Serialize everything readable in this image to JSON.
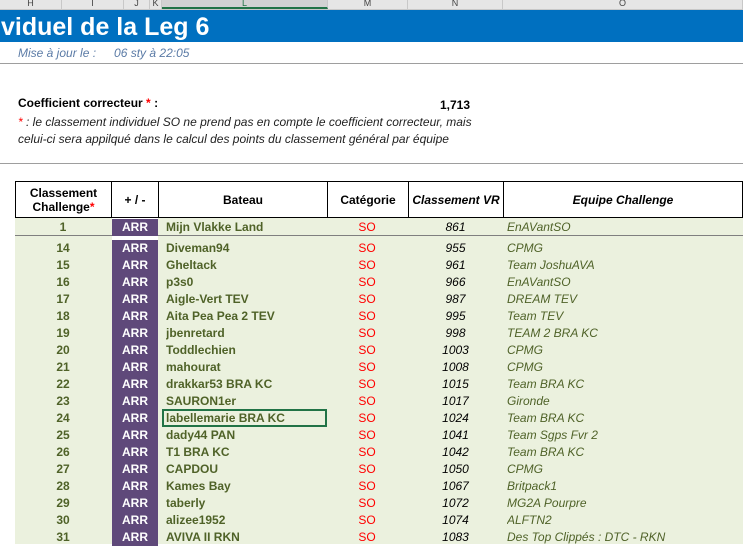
{
  "column_headers": [
    {
      "label": "H",
      "sel": false
    },
    {
      "label": "I",
      "sel": false
    },
    {
      "label": "J",
      "sel": false
    },
    {
      "label": "K",
      "sel": false
    },
    {
      "label": "L",
      "sel": true
    },
    {
      "label": "M",
      "sel": false
    },
    {
      "label": "N",
      "sel": false
    },
    {
      "label": "O",
      "sel": false
    }
  ],
  "title": "viduel de la Leg 6",
  "update": {
    "label": "Mise à jour le :",
    "value": "06 sty à 22:05"
  },
  "coefficient": {
    "label": "Coefficient correcteur",
    "star": "*",
    "colon": ":",
    "value": "1,713",
    "note_star": "*",
    "note": ": le classement individuel SO ne prend pas en compte le coefficient correcteur, mais celui-ci sera appilqué dans le calcul des points du classement général par équipe"
  },
  "table": {
    "headers": {
      "rank_line1": "Classement",
      "rank_line2": "Challenge",
      "rank_star": "*",
      "plusminus": "+ / -",
      "boat": "Bateau",
      "category": "Catégorie",
      "vr": "Classement VR",
      "team": "Equipe Challenge"
    },
    "rows": [
      {
        "rank": "1",
        "pm": "ARR",
        "boat": "Mijn Vlakke Land",
        "cat": "SO",
        "vr": "861",
        "team": "EnAVantSO"
      },
      {
        "rank": "14",
        "pm": "ARR",
        "boat": "Diveman94",
        "cat": "SO",
        "vr": "955",
        "team": "CPMG"
      },
      {
        "rank": "15",
        "pm": "ARR",
        "boat": "Gheltack",
        "cat": "SO",
        "vr": "961",
        "team": "Team JoshuAVA"
      },
      {
        "rank": "16",
        "pm": "ARR",
        "boat": "p3s0",
        "cat": "SO",
        "vr": "966",
        "team": "EnAVantSO"
      },
      {
        "rank": "17",
        "pm": "ARR",
        "boat": "Aigle-Vert TEV",
        "cat": "SO",
        "vr": "987",
        "team": "DREAM TEV"
      },
      {
        "rank": "18",
        "pm": "ARR",
        "boat": "Aita Pea Pea 2 TEV",
        "cat": "SO",
        "vr": "995",
        "team": "Team TEV"
      },
      {
        "rank": "19",
        "pm": "ARR",
        "boat": "jbenretard",
        "cat": "SO",
        "vr": "998",
        "team": "TEAM 2 BRA KC"
      },
      {
        "rank": "20",
        "pm": "ARR",
        "boat": "Toddlechien",
        "cat": "SO",
        "vr": "1003",
        "team": "CPMG"
      },
      {
        "rank": "21",
        "pm": "ARR",
        "boat": "mahourat",
        "cat": "SO",
        "vr": "1008",
        "team": "CPMG"
      },
      {
        "rank": "22",
        "pm": "ARR",
        "boat": "drakkar53 BRA KC",
        "cat": "SO",
        "vr": "1015",
        "team": "Team BRA KC"
      },
      {
        "rank": "23",
        "pm": "ARR",
        "boat": "SAURON1er",
        "cat": "SO",
        "vr": "1017",
        "team": "Gironde"
      },
      {
        "rank": "24",
        "pm": "ARR",
        "boat": "labellemarie BRA KC",
        "cat": "SO",
        "vr": "1024",
        "team": "Team BRA KC"
      },
      {
        "rank": "25",
        "pm": "ARR",
        "boat": "dady44 PAN",
        "cat": "SO",
        "vr": "1041",
        "team": "Team Sgps Fvr 2"
      },
      {
        "rank": "26",
        "pm": "ARR",
        "boat": "T1 BRA KC",
        "cat": "SO",
        "vr": "1042",
        "team": "Team BRA KC"
      },
      {
        "rank": "27",
        "pm": "ARR",
        "boat": "CAPDOU",
        "cat": "SO",
        "vr": "1050",
        "team": "CPMG"
      },
      {
        "rank": "28",
        "pm": "ARR",
        "boat": "Kames Bay",
        "cat": "SO",
        "vr": "1067",
        "team": "Britpack1"
      },
      {
        "rank": "29",
        "pm": "ARR",
        "boat": "taberly",
        "cat": "SO",
        "vr": "1072",
        "team": "MG2A Pourpre"
      },
      {
        "rank": "30",
        "pm": "ARR",
        "boat": "alizee1952",
        "cat": "SO",
        "vr": "1074",
        "team": "ALFTN2"
      },
      {
        "rank": "31",
        "pm": "ARR",
        "boat": "AVIVA II RKN",
        "cat": "SO",
        "vr": "1083",
        "team": "Des Top Clippés : DTC - RKN"
      }
    ]
  }
}
